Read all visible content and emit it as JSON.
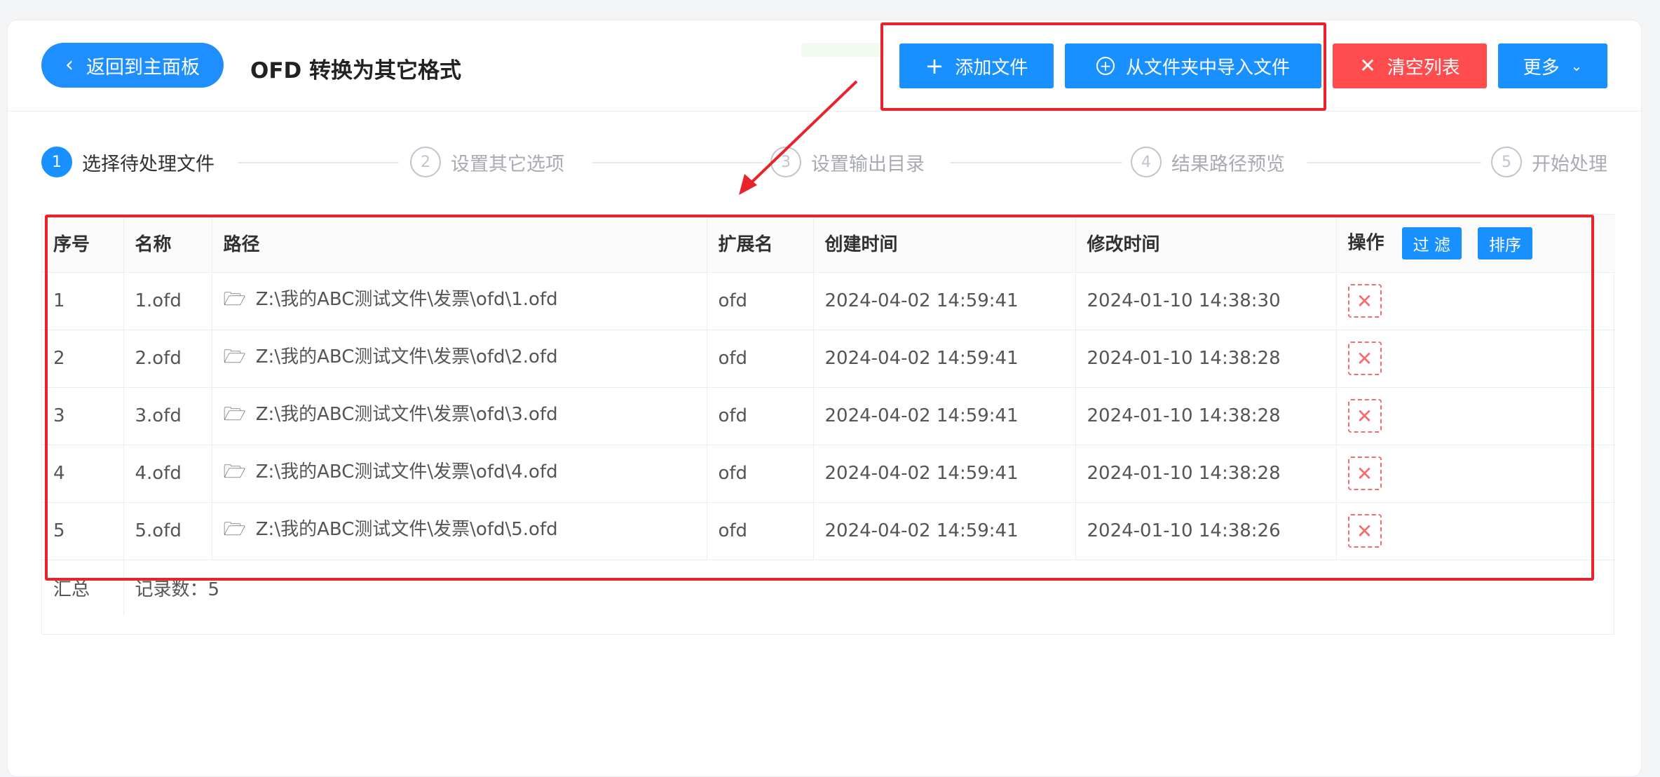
{
  "header": {
    "back_label": "返回到主面板",
    "title": "OFD 转换为其它格式",
    "buttons": {
      "add": "添加文件",
      "import_folder": "从文件夹中导入文件",
      "clear": "清空列表",
      "more": "更多"
    }
  },
  "steps": [
    {
      "num": "1",
      "label": "选择待处理文件",
      "active": true
    },
    {
      "num": "2",
      "label": "设置其它选项",
      "active": false
    },
    {
      "num": "3",
      "label": "设置输出目录",
      "active": false
    },
    {
      "num": "4",
      "label": "结果路径预览",
      "active": false
    },
    {
      "num": "5",
      "label": "开始处理",
      "active": false
    }
  ],
  "table": {
    "columns": {
      "index": "序号",
      "name": "名称",
      "path": "路径",
      "ext": "扩展名",
      "created": "创建时间",
      "modified": "修改时间",
      "ops": "操作"
    },
    "op_buttons": {
      "filter": "过 滤",
      "sort": "排序"
    },
    "rows": [
      {
        "index": "1",
        "name": "1.ofd",
        "path": "Z:\\我的ABC测试文件\\发票\\ofd\\1.ofd",
        "ext": "ofd",
        "created": "2024-04-02 14:59:41",
        "modified": "2024-01-10 14:38:30"
      },
      {
        "index": "2",
        "name": "2.ofd",
        "path": "Z:\\我的ABC测试文件\\发票\\ofd\\2.ofd",
        "ext": "ofd",
        "created": "2024-04-02 14:59:41",
        "modified": "2024-01-10 14:38:28"
      },
      {
        "index": "3",
        "name": "3.ofd",
        "path": "Z:\\我的ABC测试文件\\发票\\ofd\\3.ofd",
        "ext": "ofd",
        "created": "2024-04-02 14:59:41",
        "modified": "2024-01-10 14:38:28"
      },
      {
        "index": "4",
        "name": "4.ofd",
        "path": "Z:\\我的ABC测试文件\\发票\\ofd\\4.ofd",
        "ext": "ofd",
        "created": "2024-04-02 14:59:41",
        "modified": "2024-01-10 14:38:28"
      },
      {
        "index": "5",
        "name": "5.ofd",
        "path": "Z:\\我的ABC测试文件\\发票\\ofd\\5.ofd",
        "ext": "ofd",
        "created": "2024-04-02 14:59:41",
        "modified": "2024-01-10 14:38:26"
      }
    ],
    "summary": {
      "label": "汇总",
      "text": "记录数：5"
    }
  },
  "colors": {
    "primary": "#1890ff",
    "danger": "#ff4d4f",
    "annotation": "#e8232b"
  }
}
